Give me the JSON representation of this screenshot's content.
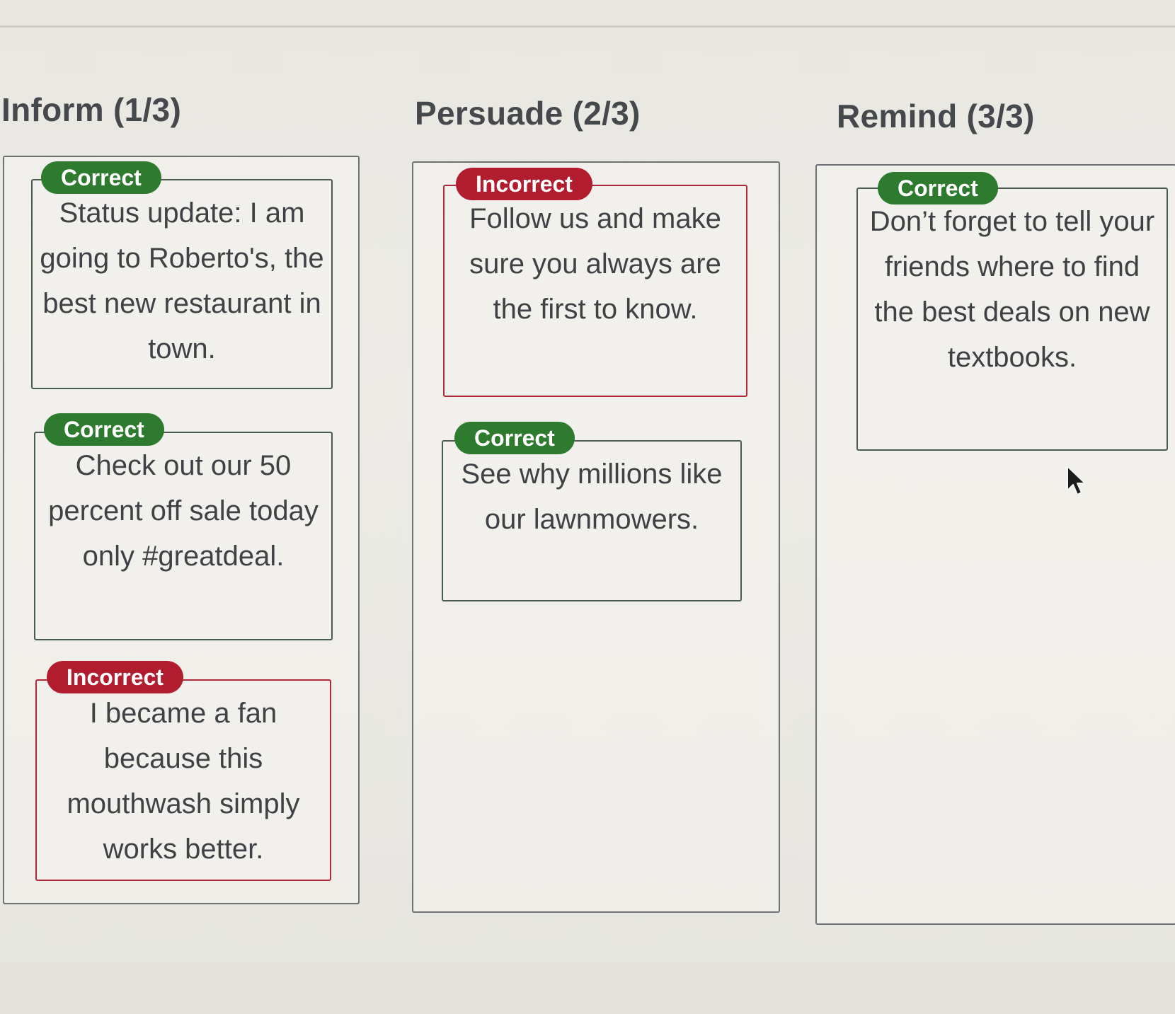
{
  "columns": [
    {
      "heading": "Inform (1/3)",
      "cards": [
        {
          "status": "Correct",
          "text": "Status update: I am going to Roberto's, the best new restaurant in town."
        },
        {
          "status": "Correct",
          "text": "Check out our 50 percent off sale today only #greatdeal."
        },
        {
          "status": "Incorrect",
          "text": "I became a fan because this mouthwash simply works better."
        }
      ]
    },
    {
      "heading": "Persuade (2/3)",
      "cards": [
        {
          "status": "Incorrect",
          "text": "Follow us and make sure you always are the first to know."
        },
        {
          "status": "Correct",
          "text": "See why millions like our lawnmowers."
        }
      ]
    },
    {
      "heading": "Remind (3/3)",
      "cards": [
        {
          "status": "Correct",
          "text": "Don’t forget to tell your friends where to find the best deals on new textbooks."
        }
      ]
    }
  ],
  "colors": {
    "correct": "#2e7a2f",
    "incorrect": "#b11d2f",
    "card_border_correct": "#4b5a4e",
    "card_border_incorrect": "#b0283b"
  },
  "icons": {
    "cursor": "mouse-pointer-icon"
  }
}
